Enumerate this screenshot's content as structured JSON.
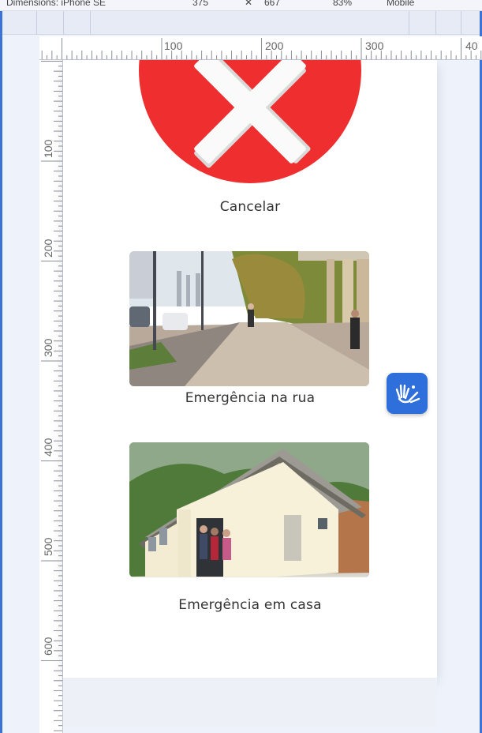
{
  "toolbar": {
    "device_label": "Dimensions: iPhone SE",
    "width_value": "375",
    "height_value": "667",
    "zoom_value": "83%",
    "throttle_value": "Mobile"
  },
  "ruler": {
    "top_labels": [
      "100",
      "200",
      "300",
      "40"
    ],
    "left_labels": [
      "100",
      "200",
      "300",
      "400",
      "500",
      "600"
    ]
  },
  "page": {
    "cancel": {
      "label": "Cancelar",
      "icon": "close-icon",
      "color": "#ef2f2f"
    },
    "options": [
      {
        "label": "Emergência na rua",
        "image": "street-sidewalk-photo"
      },
      {
        "label": "Emergência em casa",
        "image": "house-photo"
      }
    ]
  },
  "accessibility_button": {
    "icon": "sign-language-hands-icon",
    "color": "#2f6fdc"
  }
}
